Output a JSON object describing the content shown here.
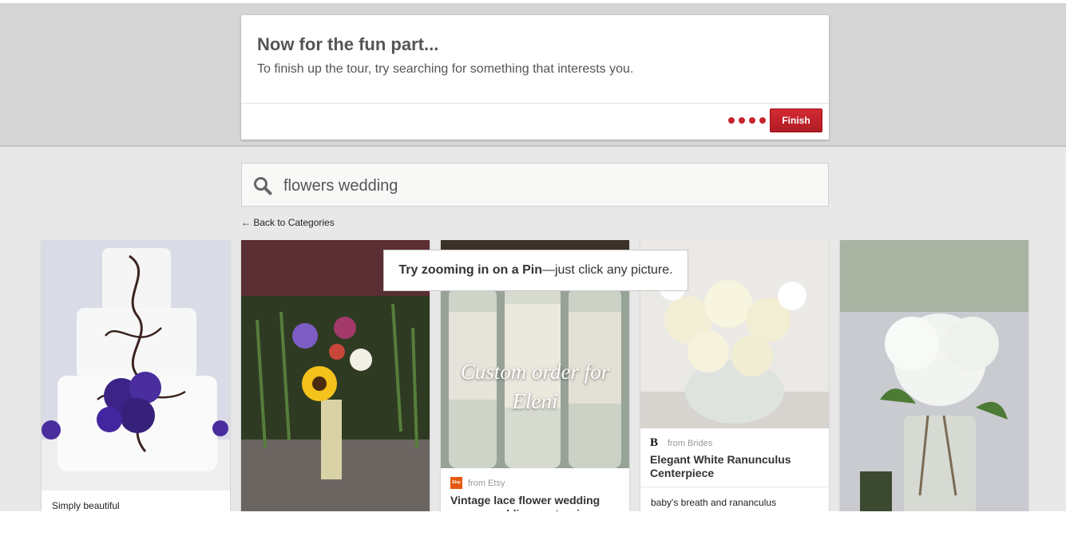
{
  "tour": {
    "title": "Now for the fun part...",
    "body": "To finish up the tour, try searching for something that interests you.",
    "step_count": 4,
    "finish_label": "Finish"
  },
  "search": {
    "value": "flowers wedding",
    "icon": "search-icon"
  },
  "back_link": "← Back to Categories",
  "tooltip": {
    "bold": "Try zooming in on a Pin",
    "rest": "—just click any picture."
  },
  "pins": [
    {
      "image": "wedding-cake-purple-flowers",
      "description": "Simply beautiful"
    },
    {
      "image": "sunflower-bouquet"
    },
    {
      "image": "lace-vases",
      "image_text": [
        "Custom order for",
        "Eleni"
      ],
      "source_icon": "etsy-icon",
      "source": "from Etsy",
      "title": "Vintage lace flower wedding vases, wedding centerpiece"
    },
    {
      "image": "white-ranunculus-centerpiece",
      "source_icon": "brides-icon",
      "source": "from Brides",
      "title": "Elegant White Ranunculus Centerpiece",
      "description": "baby's breath and rananculus"
    },
    {
      "image": "white-hydrangea-jar"
    }
  ],
  "colors": {
    "accent": "#c6242d",
    "banner": "#d6d6d6",
    "background": "#e8e8e8"
  }
}
